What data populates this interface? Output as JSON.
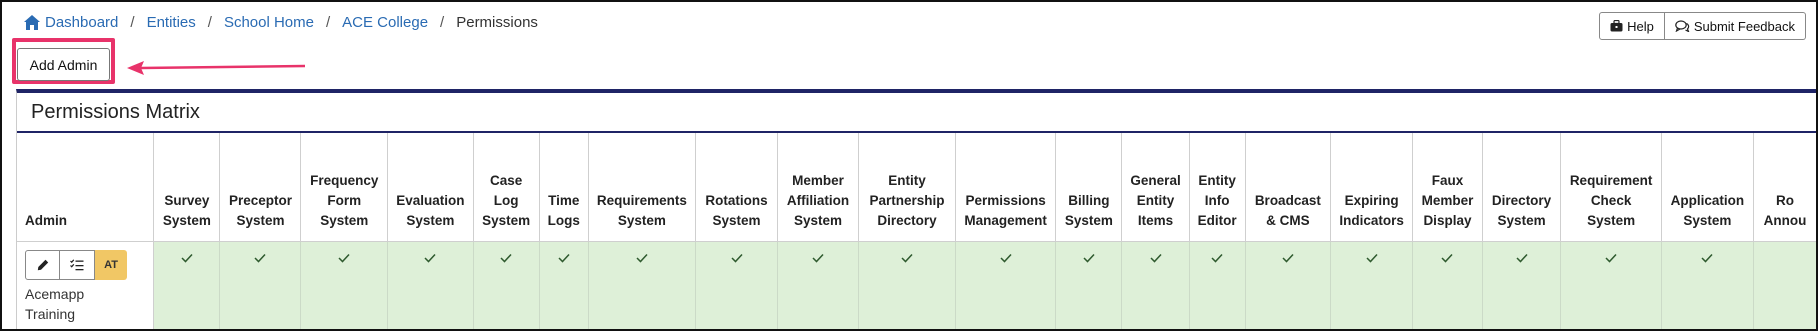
{
  "breadcrumb": {
    "items": [
      "Dashboard",
      "Entities",
      "School Home",
      "ACE College"
    ],
    "current": "Permissions",
    "separator": "/"
  },
  "header_buttons": {
    "help": "Help",
    "feedback": "Submit Feedback"
  },
  "add_admin": {
    "label": "Add Admin"
  },
  "highlight_color": "#e8336a",
  "panel": {
    "title": "Permissions Matrix",
    "accent_color": "#1f2466"
  },
  "matrix": {
    "admin_header": "Admin",
    "columns": [
      "Survey System",
      "Preceptor System",
      "Frequency Form System",
      "Evaluation System",
      "Case Log System",
      "Time Logs",
      "Requirements System",
      "Rotations System",
      "Member Affiliation System",
      "Entity Partnership Directory",
      "Permissions Management",
      "Billing System",
      "General Entity Items",
      "Entity Info Editor",
      "Broadcast & CMS",
      "Expiring Indicators",
      "Faux Member Display",
      "Directory System",
      "Requirement Check System",
      "Application System",
      "Ro Annou"
    ],
    "rows": [
      {
        "name": "Acemapp Training",
        "initials": "AT",
        "permissions": [
          true,
          true,
          true,
          true,
          true,
          true,
          true,
          true,
          true,
          true,
          true,
          true,
          true,
          true,
          true,
          true,
          true,
          true,
          true,
          true,
          false
        ]
      }
    ],
    "granted_color": "#def0d8",
    "check_color": "#2e5a2e"
  },
  "icons": [
    "home-icon",
    "briefcase-icon",
    "chat-bubbles-icon",
    "arrow-icon",
    "pencil-icon",
    "list-check-icon",
    "check-icon"
  ]
}
